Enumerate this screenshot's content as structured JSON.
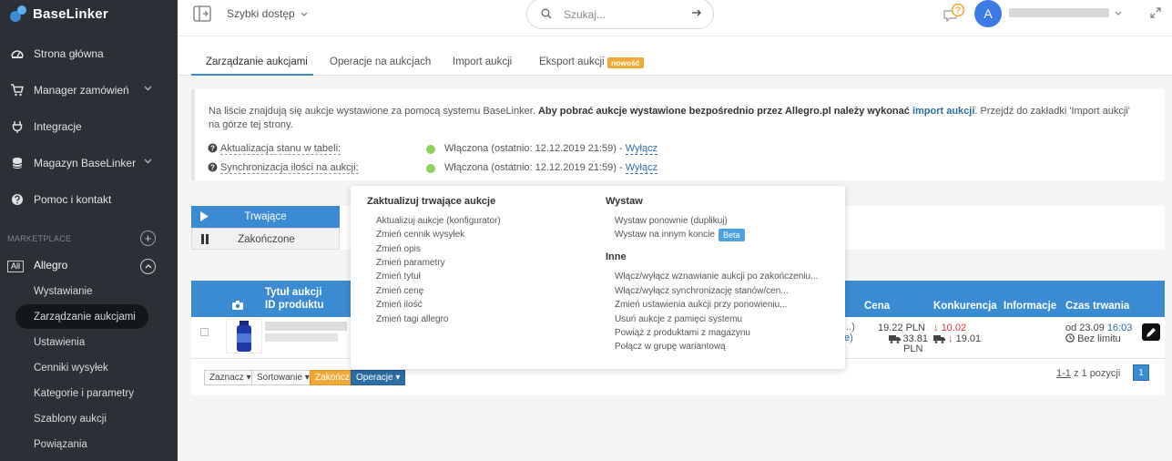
{
  "brand": {
    "name": "BaseLinker"
  },
  "sidebar": {
    "items": [
      {
        "label": "Strona główna",
        "icon": "dashboard-icon"
      },
      {
        "label": "Manager zamówień",
        "icon": "cart-icon"
      },
      {
        "label": "Integracje",
        "icon": "plug-icon"
      },
      {
        "label": "Magazyn BaseLinker",
        "icon": "database-icon"
      },
      {
        "label": "Pomoc i kontakt",
        "icon": "help-icon"
      }
    ],
    "section_label": "MARKETPLACE",
    "marketplace": {
      "badge": "All",
      "label": "Allegro",
      "subitems": [
        "Wystawianie",
        "Zarządzanie aukcjami",
        "Ustawienia",
        "Cenniki wysyłek",
        "Kategorie i parametry",
        "Szablony aukcji",
        "Powiązania"
      ],
      "active_subitem": "Zarządzanie aukcjami"
    }
  },
  "topbar": {
    "quick_access": "Szybki dostęp",
    "search_placeholder": "Szukaj...",
    "avatar_initial": "A",
    "notification_badge": "?"
  },
  "tabs": [
    {
      "label": "Zarządzanie aukcjami",
      "active": true
    },
    {
      "label": "Operacje na aukcjach"
    },
    {
      "label": "Import aukcji"
    },
    {
      "label": "Eksport aukcji",
      "badge": "nowość"
    }
  ],
  "info": {
    "text_1": "Na liście znajdują się aukcje wystawione za pomocą systemu BaseLinker. ",
    "text_bold": "Aby pobrać aukcje wystawione bezpośrednio przez Allegro.pl należy wykonać ",
    "text_link": "import aukcji",
    "text_2": ". Przejdź do zakładki 'Import aukcji' na górze tej strony.",
    "rows": [
      {
        "label": "Aktualizacja stanu w tabeli:",
        "value": "Włączona (ostatnio: 12.12.2019 21:59) - ",
        "action": "Wyłącz"
      },
      {
        "label": "Synchronizacja ilości na aukcji:",
        "value": "Włączona (ostatnio: 12.12.2019 21:59) - ",
        "action": "Wyłącz"
      }
    ]
  },
  "filter": {
    "active": "Trwające",
    "ended": "Zakończone"
  },
  "table": {
    "headers": {
      "title": "Tytuł aukcji",
      "id": "ID produktu",
      "price": "Cena",
      "competition": "Konkurencja",
      "info": "Informacje",
      "duration": "Czas trwania"
    },
    "row": {
      "partial_1": "..)",
      "partial_2": "e)",
      "price": "19.22 PLN",
      "shipping_price": "33.81",
      "shipping_currency": "PLN",
      "competition_price": "10.02",
      "competition_shipping": "19.01",
      "duration_from": "od 23.09",
      "duration_time": "16:03",
      "duration_limit": "Bez limitu"
    },
    "footer": {
      "btn_select": "Zaznacz",
      "btn_sort": "Sortowanie",
      "btn_end": "Zakończ",
      "btn_ops": "Operacje",
      "paging_range": "1-1",
      "paging_text": " z 1 pozycji",
      "page": "1"
    },
    "colors": {
      "header": "#3b8bd2",
      "end_button": "#f0a836"
    }
  },
  "dropdown": {
    "col1": {
      "heading": "Zaktualizuj trwające aukcje",
      "items": [
        "Aktualizuj aukcje (konfigurator)",
        "Zmień cennik wysyłek",
        "Zmień opis",
        "Zmień parametry",
        "Zmień tytuł",
        "Zmień cenę",
        "Zmień ilość",
        "Zmień tagi allegro"
      ]
    },
    "col2": {
      "heading": "Wystaw",
      "items": [
        "Wystaw ponownie (duplikuj)",
        "Wystaw na innym koncie"
      ],
      "beta": "Beta",
      "heading2": "Inne",
      "items2": [
        "Włącz/wyłącz wznawianie aukcji po zakończeniu...",
        "Włącz/wyłącz synchronizację stanów/cen...",
        "Zmień ustawienia aukcji przy ponowieniu...",
        "Usuń aukcje z pamięci systemu",
        "Powiąż z produktami z magazynu",
        "Połącz w grupę wariantową"
      ]
    }
  }
}
